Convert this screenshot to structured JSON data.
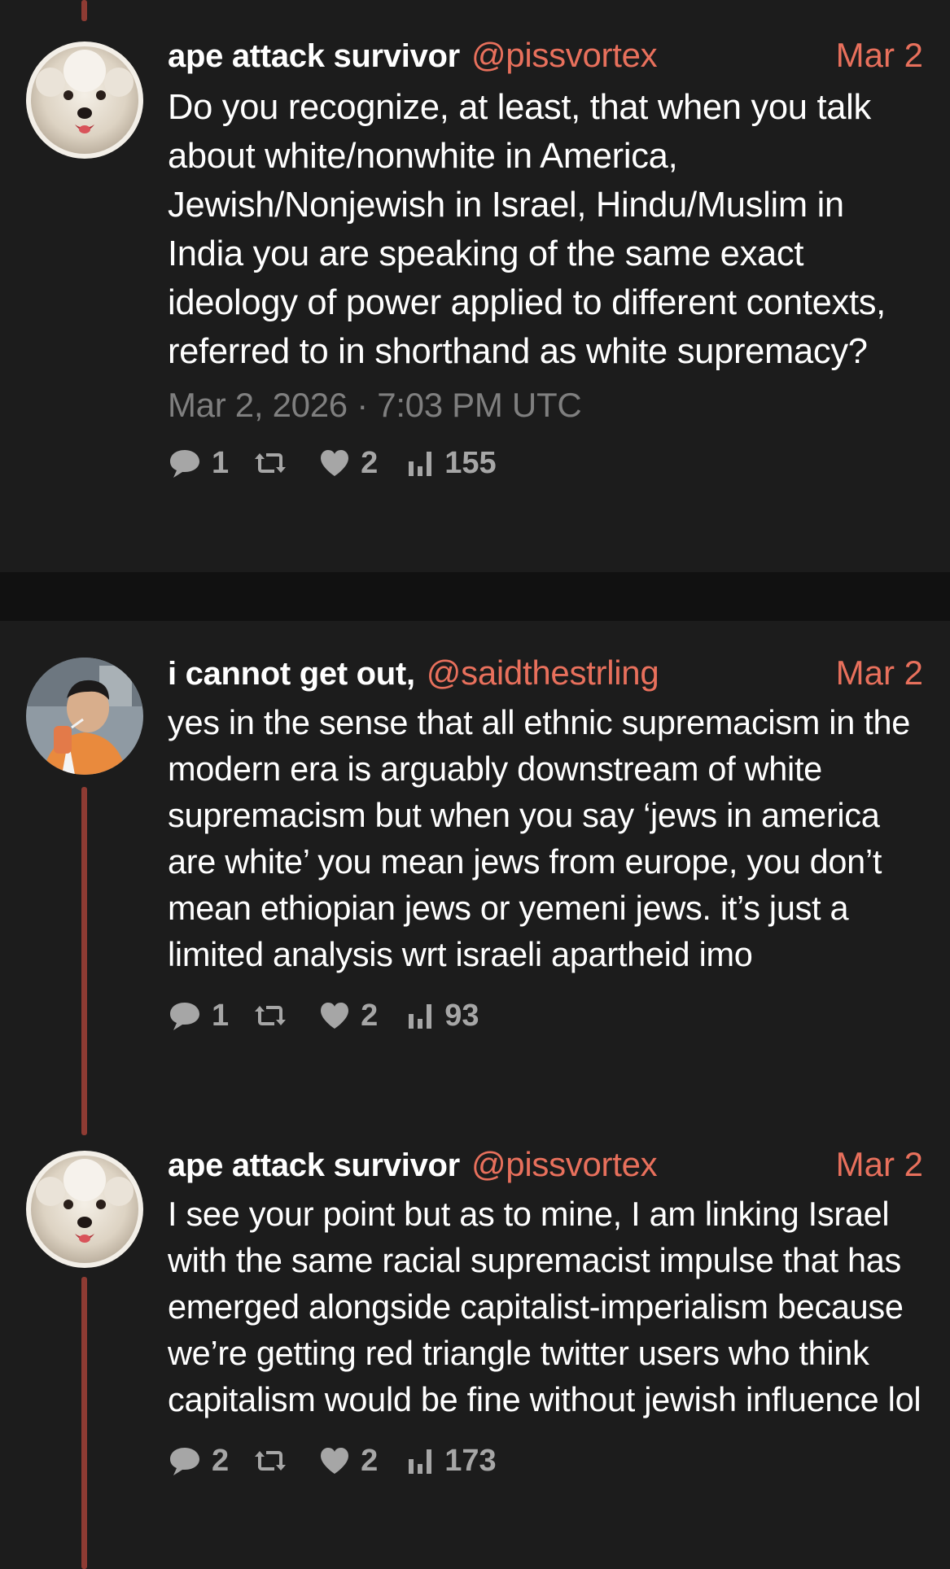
{
  "posts": [
    {
      "author": "ape attack survivor",
      "handle": "@pissvortex",
      "date": "Mar 2",
      "text": "Do you recognize, at least, that when you talk about white/nonwhite in America, Jewish/Nonjewish in Israel, Hindu/Muslim in India you are speaking of the same exact ideology of power applied to different contexts, referred to in shorthand as white supremacy?",
      "timestamp": "Mar 2, 2026 · 7:03 PM UTC",
      "replies": "1",
      "likes": "2",
      "views": "155",
      "avatar": "bichon-dog-avatar"
    },
    {
      "author": "i cannot get out,",
      "handle": "@saidthestrling",
      "date": "Mar 2",
      "text": "yes in the sense that all ethnic supremacism in the modern era is arguably downstream of white supremacism but when you say ‘jews in america are white’ you mean jews from europe, you don’t mean ethiopian jews or yemeni jews. it’s just a limited analysis wrt israeli apartheid imo",
      "replies": "1",
      "likes": "2",
      "views": "93",
      "avatar": "man-drinking-avatar"
    },
    {
      "author": "ape attack survivor",
      "handle": "@pissvortex",
      "date": "Mar 2",
      "text": "I see your point but as to mine, I am linking Israel with the same racial supremacist impulse that has emerged alongside capitalist-imperialism because we’re getting red triangle twitter users who think capitalism would be fine without jewish influence lol",
      "replies": "2",
      "likes": "2",
      "views": "173",
      "avatar": "bichon-dog-avatar"
    }
  ],
  "colors": {
    "background": "#1c1c1c",
    "separator": "#111111",
    "accent": "#e8705c",
    "thread_line": "#8e3b33",
    "muted": "#7f7f7f",
    "stat": "#a6a6a6"
  },
  "icons": [
    "comment-icon",
    "retweet-icon",
    "heart-icon",
    "views-icon"
  ]
}
